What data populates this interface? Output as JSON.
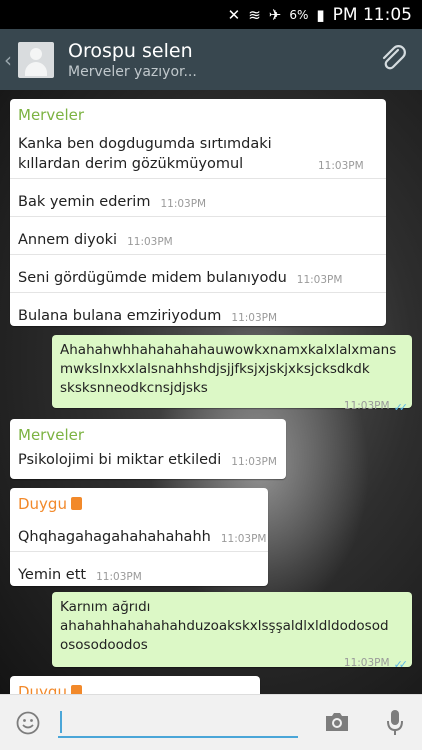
{
  "status_bar": {
    "battery": "6%",
    "time": "PM 11:05"
  },
  "header": {
    "contact_name": "Orospu selen",
    "status": "Merveler yazıyor..."
  },
  "messages": [
    {
      "type": "in",
      "sender": "Merveler",
      "sender_color": "#7cb342",
      "lines": [
        {
          "text": "Kanka ben dogdugumda sırtımdaki kıllardan derim gözükmüyomul",
          "time": "11:03PM"
        },
        {
          "text": "Bak yemin ederim",
          "time": "11:03PM"
        },
        {
          "text": "Annem diyoki",
          "time": "11:03PM"
        },
        {
          "text": "Seni gördügümde midem bulanıyodu",
          "time": "11:03PM"
        },
        {
          "text": "Bulana bulana emziriyodum",
          "time": "11:03PM"
        }
      ]
    },
    {
      "type": "out",
      "text": "Ahahahwhhahahahahauwowkxnamxkalxlalxmans mwkslnxkxlalsnahhshdjsjjfksjxjskjxksjcksdkdk sksksnneodkcnsjdjsks",
      "time": "11:03PM"
    },
    {
      "type": "in",
      "sender": "Merveler",
      "sender_color": "#7cb342",
      "lines": [
        {
          "text": "Psikolojimi bi miktar etkiledi",
          "time": "11:03PM"
        }
      ]
    },
    {
      "type": "in",
      "sender": "Duygu",
      "sender_color": "#f2892a",
      "lines": [
        {
          "text": "Qhqhagahagahahahahahh",
          "time": "11:03PM"
        },
        {
          "text": "Yemin ett",
          "time": "11:03PM"
        }
      ]
    },
    {
      "type": "out",
      "text": "Karnım ağrıdı ahahahhahahahahduzoakskxlsşşaldlxldldodosod ososodoodos",
      "time": "11:03PM"
    },
    {
      "type": "in",
      "sender": "Duygu",
      "sender_color": "#f2892a",
      "lines": []
    }
  ],
  "icons": {
    "back": "chevron-left-icon",
    "attach": "paperclip-icon",
    "emoji": "smiley-icon",
    "camera": "camera-icon",
    "mic": "microphone-icon"
  }
}
